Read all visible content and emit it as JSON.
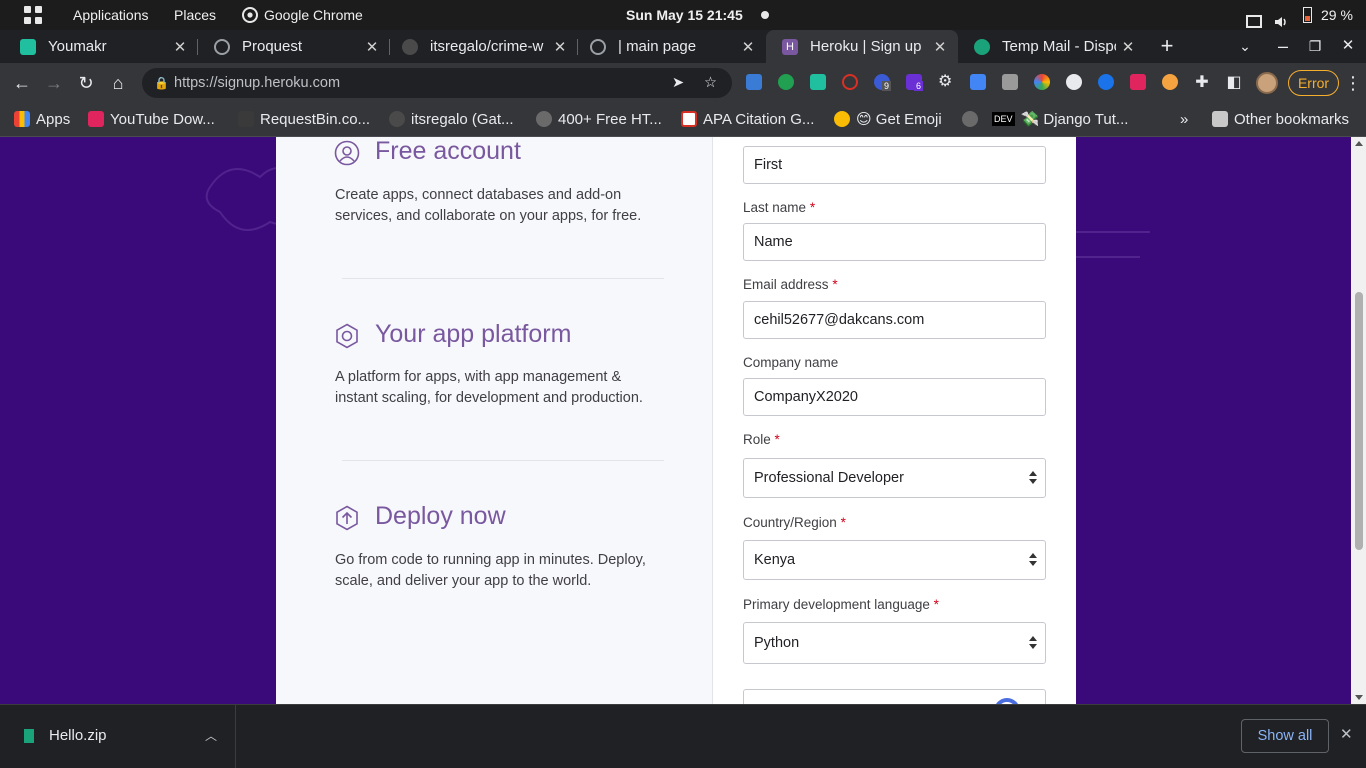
{
  "system_bar": {
    "applications": "Applications",
    "places": "Places",
    "active_app": "Google Chrome",
    "datetime": "Sun May 15  21:45",
    "battery": "29 %"
  },
  "tabs": [
    {
      "title": "Youmakr",
      "color": "#1fbfa0"
    },
    {
      "title": "Proquest",
      "color": "#9aa0a6"
    },
    {
      "title": "itsregalo/crime-w",
      "color": "#6e6e6e"
    },
    {
      "title": "| main page",
      "color": "#9aa0a6"
    },
    {
      "title": "Heroku | Sign up",
      "color": "#79589f"
    },
    {
      "title": "Temp Mail - Dispo",
      "color": "#1aa37a"
    }
  ],
  "toolbar": {
    "url": "https://signup.heroku.com",
    "error_label": "Error",
    "ext_badges": [
      "9",
      "6"
    ]
  },
  "bookmarks": {
    "items": [
      "Apps",
      "YouTube Dow...",
      "RequestBin.co...",
      "itsregalo (Gat...",
      "400+ Free HT...",
      "APA Citation G...",
      "😊 Get Emoji",
      "💸 Django Tut..."
    ],
    "dev_badge": "DEV",
    "overflow": "»",
    "other": "Other bookmarks"
  },
  "features": [
    {
      "title": "Free account",
      "desc": "Create apps, connect databases and add-on services, and collaborate on your apps, for free.",
      "icon": "user-icon"
    },
    {
      "title": "Your app platform",
      "desc": "A platform for apps, with app management & instant scaling, for development and production.",
      "icon": "hexagon-icon"
    },
    {
      "title": "Deploy now",
      "desc": "Go from code to running app in minutes. Deploy, scale, and deliver your app to the world.",
      "icon": "upload-icon"
    }
  ],
  "form": {
    "first_name_value": "First",
    "last_name_label": "Last name",
    "last_name_value": "Name",
    "email_label": "Email address",
    "email_value": "cehil52677@dakcans.com",
    "company_label": "Company name",
    "company_value": "CompanyX2020",
    "role_label": "Role",
    "role_value": "Professional Developer",
    "country_label": "Country/Region",
    "country_value": "Kenya",
    "language_label": "Primary development language",
    "language_value": "Python",
    "required_mark": "*"
  },
  "download_bar": {
    "file": "Hello.zip",
    "show_all": "Show all"
  },
  "colors": {
    "heroku_purple": "#79589f",
    "page_bg": "#3a0a7a",
    "error_orange": "#f6ae2d"
  }
}
